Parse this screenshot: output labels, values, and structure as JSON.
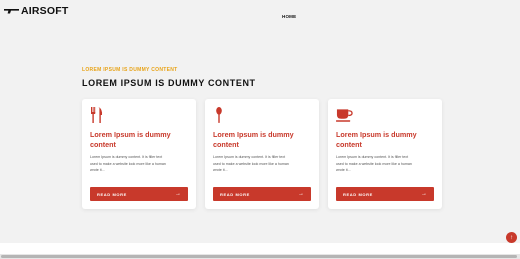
{
  "header": {
    "logo_text": "AIRSOFT",
    "nav_items": [
      "HOME"
    ]
  },
  "section": {
    "eyebrow": "LOREM IPSUM IS DUMMY CONTENT",
    "title": "LOREM IPSUM IS DUMMY CONTENT"
  },
  "cards": [
    {
      "icon": "fork-knife-icon",
      "title": "Lorem Ipsum is dummy content",
      "text": "Lorem Ipsum is dummy content. It is filler text used to make a website look more like a human wrote it...",
      "button_label": "READ MORE",
      "button_arrow": "→"
    },
    {
      "icon": "spoon-icon",
      "title": "Lorem Ipsum is dummy content",
      "text": "Lorem Ipsum is dummy content. It is filler text used to make a website look more like a human wrote it...",
      "button_label": "READ MORE",
      "button_arrow": "→"
    },
    {
      "icon": "coffee-cup-icon",
      "title": "Lorem Ipsum is dummy content",
      "text": "Lorem Ipsum is dummy content. It is filler text used to make a website look more like a human wrote it...",
      "button_label": "READ MORE",
      "button_arrow": "→"
    }
  ],
  "floating_button": {
    "icon": "arrow-up-icon",
    "glyph": "↑"
  },
  "colors": {
    "accent": "#c8392b",
    "eyebrow": "#e8a317",
    "background": "#f2f2f2"
  }
}
